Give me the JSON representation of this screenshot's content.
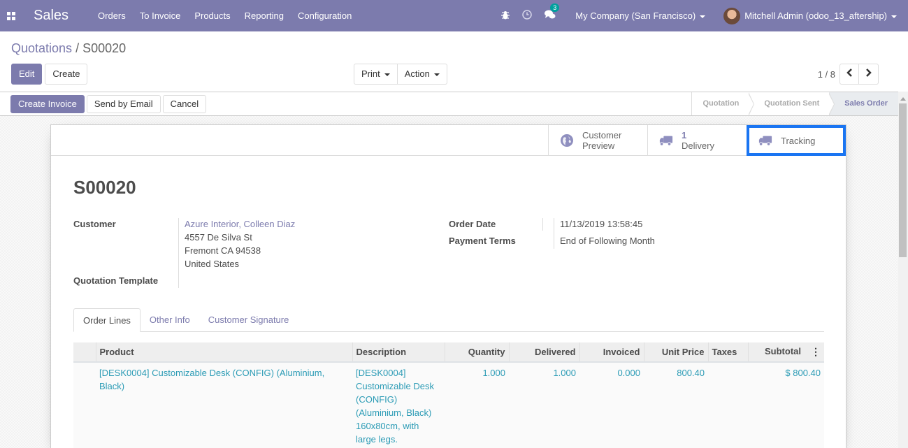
{
  "navbar": {
    "app_name": "Sales",
    "menu": [
      "Orders",
      "To Invoice",
      "Products",
      "Reporting",
      "Configuration"
    ],
    "message_count": "3",
    "company": "My Company (San Francisco)",
    "user": "Mitchell Admin (odoo_13_aftership)",
    "icons": [
      "apps-icon",
      "bug-icon",
      "clock-icon",
      "chat-icon"
    ]
  },
  "breadcrumb": {
    "parent": "Quotations",
    "separator": " / ",
    "current": "S00020"
  },
  "control_panel": {
    "edit_label": "Edit",
    "create_label": "Create",
    "print_label": "Print",
    "action_label": "Action",
    "pager_value": "1 / 8"
  },
  "statusbar": {
    "buttons": [
      "Create Invoice",
      "Send by Email",
      "Cancel"
    ],
    "stages": [
      "Quotation",
      "Quotation Sent",
      "Sales Order"
    ],
    "active_stage": "Sales Order"
  },
  "smart_buttons": {
    "customer_preview": {
      "line1": "Customer",
      "line2": "Preview"
    },
    "delivery": {
      "value": "1",
      "label": "Delivery"
    },
    "tracking": {
      "label": "Tracking"
    }
  },
  "record": {
    "name": "S00020",
    "customer_label": "Customer",
    "customer_name": "Azure Interior, Colleen Diaz",
    "address_line1": "4557 De Silva St",
    "address_line2": "Fremont CA 94538",
    "address_line3": "United States",
    "quotation_template_label": "Quotation Template",
    "quotation_template_value": "",
    "order_date_label": "Order Date",
    "order_date": "11/13/2019 13:58:45",
    "payment_terms_label": "Payment Terms",
    "payment_terms": "End of Following Month"
  },
  "tabs": [
    {
      "label": "Order Lines",
      "active": true
    },
    {
      "label": "Other Info",
      "active": false
    },
    {
      "label": "Customer Signature",
      "active": false
    }
  ],
  "order_lines": {
    "columns": [
      "Product",
      "Description",
      "Quantity",
      "Delivered",
      "Invoiced",
      "Unit Price",
      "Taxes",
      "Subtotal"
    ],
    "rows": [
      {
        "product": "[DESK0004] Customizable Desk (CONFIG) (Aluminium, Black)",
        "description": "[DESK0004] Customizable Desk (CONFIG) (Aluminium, Black) 160x80cm, with large legs.",
        "quantity": "1.000",
        "delivered": "1.000",
        "invoiced": "0.000",
        "unit_price": "800.40",
        "taxes": "",
        "subtotal": "$ 800.40"
      }
    ]
  },
  "colors": {
    "brand": "#7c7bad",
    "link_teal": "#2b9bb5",
    "highlight": "#1a75f2"
  }
}
